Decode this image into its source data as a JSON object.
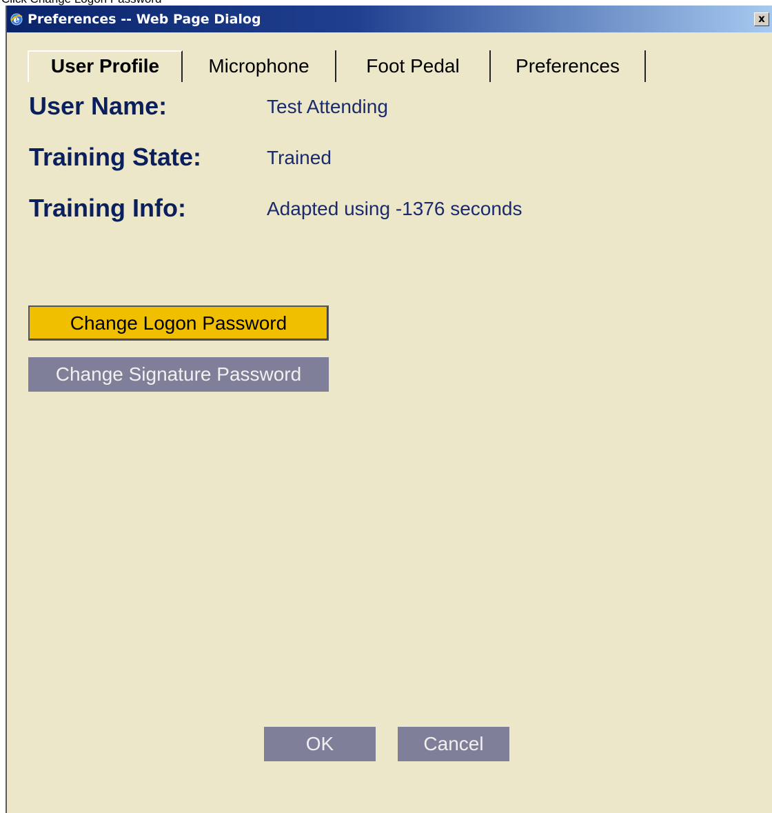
{
  "tooltip": {
    "text": "Click Change Logon Password"
  },
  "window": {
    "title": "Preferences -- Web Page Dialog",
    "close_glyph": "x",
    "icon": "ie-icon"
  },
  "tabs": [
    {
      "label": "User Profile",
      "active": true
    },
    {
      "label": "Microphone",
      "active": false
    },
    {
      "label": "Foot Pedal",
      "active": false
    },
    {
      "label": "Preferences",
      "active": false
    }
  ],
  "profile": {
    "user_name_label": "User Name:",
    "user_name_value": "Test Attending",
    "training_state_label": "Training State:",
    "training_state_value": "Trained",
    "training_info_label": "Training Info:",
    "training_info_value": "Adapted using -1376 seconds"
  },
  "buttons": {
    "change_logon": "Change Logon Password",
    "change_signature": "Change Signature Password",
    "ok": "OK",
    "cancel": "Cancel"
  },
  "colors": {
    "dialog_bg": "#ece7c9",
    "title_bar": "#0a246a",
    "label_text": "#0a1f5c",
    "primary_button": "#f0c000",
    "secondary_button": "#7f7f9a"
  }
}
